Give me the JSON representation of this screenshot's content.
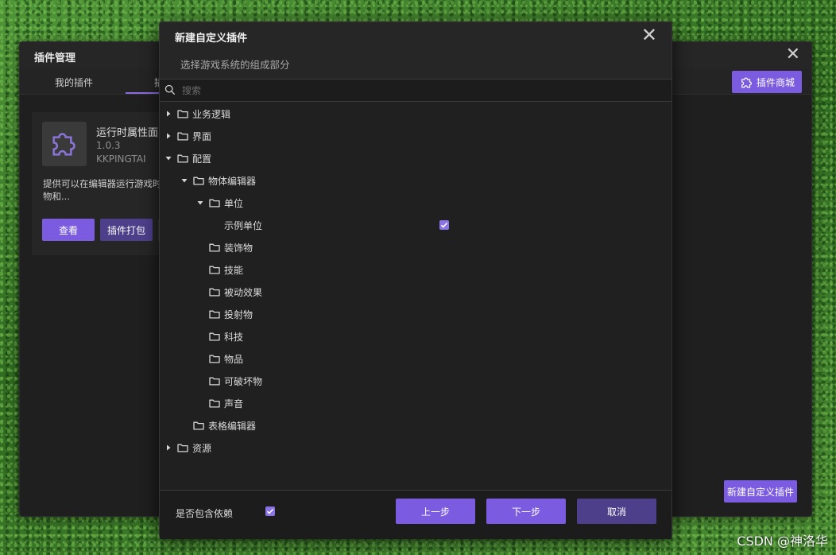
{
  "manager": {
    "title": "插件管理",
    "tabs": [
      {
        "label": "我的插件"
      },
      {
        "label": "插"
      }
    ],
    "store_button": "插件商城",
    "card": {
      "name": "运行时属性面",
      "version": "1.0.3",
      "author": "KKPINGTAI",
      "description": "提供可以在编辑器运行游戏时坏物和...",
      "view_button": "查看",
      "pack_button": "插件打包"
    },
    "new_plugin_button": "新建自定义插件"
  },
  "dialog": {
    "title": "新建自定义插件",
    "subtitle": "选择游戏系统的组成部分",
    "search_placeholder": "搜索",
    "tree": [
      {
        "label": "业务逻辑",
        "level": 0,
        "expander": "collapsed"
      },
      {
        "label": "界面",
        "level": 0,
        "expander": "collapsed"
      },
      {
        "label": "配置",
        "level": 0,
        "expander": "expanded"
      },
      {
        "label": "物体编辑器",
        "level": 1,
        "expander": "expanded"
      },
      {
        "label": "单位",
        "level": 2,
        "expander": "expanded"
      },
      {
        "label": "示例单位",
        "level": 3,
        "expander": "none",
        "leaf": true,
        "checked": true
      },
      {
        "label": "装饰物",
        "level": 2,
        "expander": "none"
      },
      {
        "label": "技能",
        "level": 2,
        "expander": "none"
      },
      {
        "label": "被动效果",
        "level": 2,
        "expander": "none"
      },
      {
        "label": "投射物",
        "level": 2,
        "expander": "none"
      },
      {
        "label": "科技",
        "level": 2,
        "expander": "none"
      },
      {
        "label": "物品",
        "level": 2,
        "expander": "none"
      },
      {
        "label": "可破坏物",
        "level": 2,
        "expander": "none"
      },
      {
        "label": "声音",
        "level": 2,
        "expander": "none"
      },
      {
        "label": "表格编辑器",
        "level": 1,
        "expander": "none"
      },
      {
        "label": "资源",
        "level": 0,
        "expander": "collapsed"
      }
    ],
    "include_dependencies_label": "是否包含依赖",
    "include_dependencies": true,
    "buttons": {
      "prev": "上一步",
      "next": "下一步",
      "cancel": "取消"
    }
  },
  "watermark": "CSDN @神洛华",
  "colors": {
    "accent": "#7b5ce0",
    "accent_dark": "#4d3f8a",
    "panel": "#202020",
    "checkbox": "#8c74e6"
  }
}
